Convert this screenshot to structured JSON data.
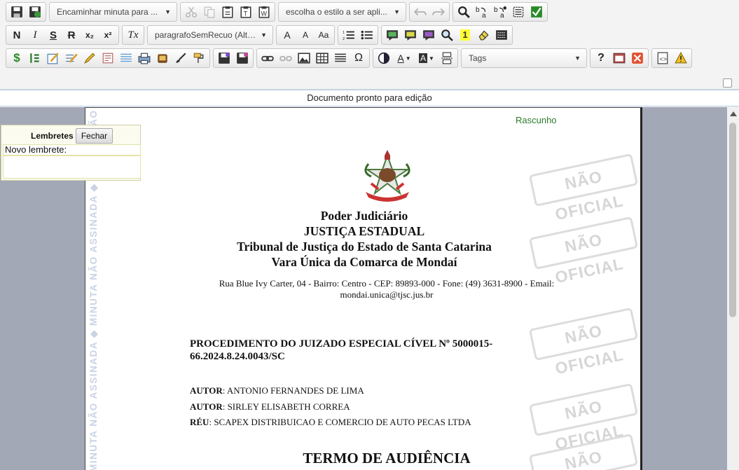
{
  "toolbar": {
    "row1": {
      "forward_combo": "Encaminhar minuta para ...",
      "style_combo": "escolha o estilo a ser apli..."
    },
    "row2": {
      "bold": "N",
      "italic": "I",
      "underline": "S",
      "strike": "R",
      "subscript": "x₂",
      "superscript": "x²",
      "clear_format": "Tx",
      "paragraph_combo": "paragrafoSemRecuo (Alt ...",
      "font_increase": "A",
      "font_decrease": "A",
      "font_case": "Aa",
      "highlight_number": "1"
    },
    "row3": {
      "tags_combo": "Tags",
      "help": "?",
      "omega": "Ω"
    }
  },
  "status": {
    "message": "Documento pronto para edição"
  },
  "reminders": {
    "title": "Lembretes",
    "close_label": "Fechar",
    "new_label": "Novo lembrete:",
    "new_value": ""
  },
  "document": {
    "draft_label": "Rascunho",
    "stamp_text": "NÃO OFICIAL",
    "side_watermark": "MINUTA NÃO ASSINADA  ◆  MINUTA NÃO ASSINADA  ◆  MINUTA NÃO ASSINADA",
    "header": {
      "line1": "Poder Judiciário",
      "line2": "JUSTIÇA ESTADUAL",
      "line3": "Tribunal de Justiça do Estado de Santa Catarina",
      "line4": "Vara Única da Comarca de Mondaí"
    },
    "address": "Rua Blue Ivy Carter, 04 - Bairro: Centro - CEP: 89893-000 - Fone: (49) 3631-8900 - Email: mondai.unica@tjsc.jus.br",
    "procedure": "PROCEDIMENTO DO JUIZADO ESPECIAL CÍVEL Nº 5000015-66.2024.8.24.0043/SC",
    "parties": [
      {
        "role": "AUTOR",
        "name": ": ANTONIO FERNANDES DE LIMA"
      },
      {
        "role": "AUTOR",
        "name": ": SIRLEY ELISABETH CORREA"
      },
      {
        "role": "RÉU",
        "name": ": SCAPEX DISTRIBUICAO E COMERCIO DE AUTO PECAS LTDA"
      }
    ],
    "title": "TERMO DE AUDIÊNCIA"
  }
}
